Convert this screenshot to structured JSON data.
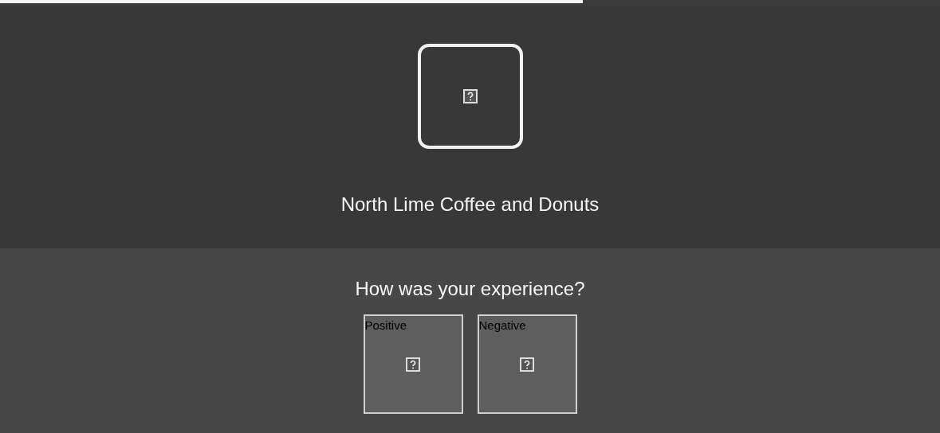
{
  "progress": {
    "level": 0.62
  },
  "business": {
    "name": "North Lime Coffee and Donuts"
  },
  "survey": {
    "question": "How was your experience?",
    "options": [
      {
        "label": "Positive"
      },
      {
        "label": "Negative"
      }
    ]
  }
}
